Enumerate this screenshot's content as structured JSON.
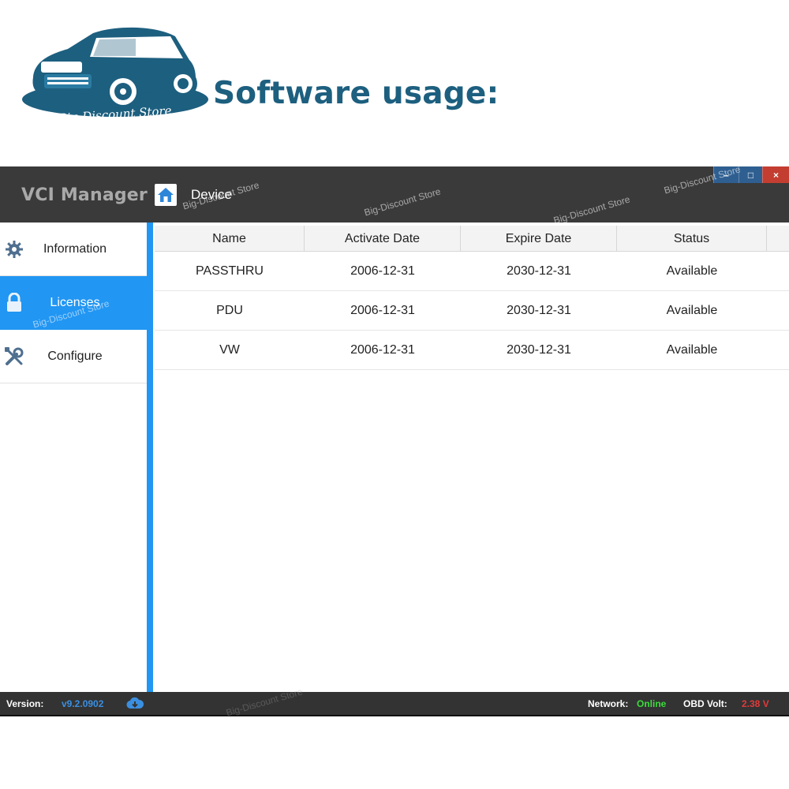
{
  "banner": {
    "logo_text": "Big-Discount Store",
    "title": "Software usage:"
  },
  "window": {
    "app_name": "VCI Manager",
    "breadcrumb": "Device",
    "controls": {
      "minimize": "–",
      "maximize": "□",
      "close": "×"
    }
  },
  "sidebar": {
    "items": [
      {
        "label": "Information",
        "icon": "gear-icon",
        "active": false
      },
      {
        "label": "Licenses",
        "icon": "lock-icon",
        "active": true
      },
      {
        "label": "Configure",
        "icon": "tools-icon",
        "active": false
      }
    ]
  },
  "licenses": {
    "columns": [
      "Name",
      "Activate Date",
      "Expire Date",
      "Status"
    ],
    "rows": [
      [
        "PASSTHRU",
        "2006-12-31",
        "2030-12-31",
        "Available"
      ],
      [
        "PDU",
        "2006-12-31",
        "2030-12-31",
        "Available"
      ],
      [
        "VW",
        "2006-12-31",
        "2030-12-31",
        "Available"
      ]
    ]
  },
  "statusbar": {
    "version_label": "Version:",
    "version_value": "v9.2.0902",
    "network_label": "Network:",
    "network_value": "Online",
    "obd_label": "OBD Volt:",
    "obd_value": "2.38 V"
  },
  "watermark": "Big-Discount Store",
  "colors": {
    "accent": "#2196f3",
    "titlebar": "#3a3a3a",
    "banner_title": "#1d5f7f",
    "online": "#3ddc3d",
    "volt": "#e23a3a"
  }
}
